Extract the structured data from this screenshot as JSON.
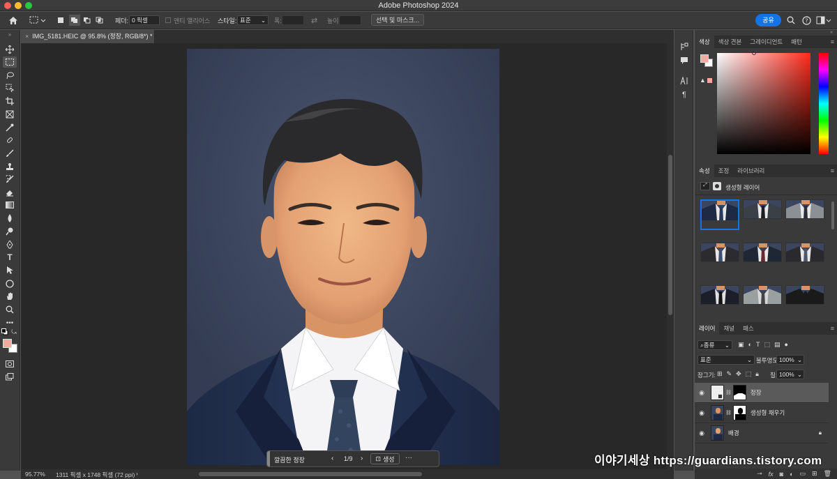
{
  "window": {
    "title": "Adobe Photoshop 2024"
  },
  "options_bar": {
    "feather_label": "페더:",
    "feather_value": "0 픽셀",
    "antialias_label": "앤티 앨리어스",
    "style_label": "스타일:",
    "style_value": "표준",
    "width_label": "폭:",
    "height_label": "높이:",
    "select_mask_button": "선택 및 마스크...",
    "share_button": "공유"
  },
  "document": {
    "tab_title": "IMG_5181.HEIC @ 95.8% (정장, RGB/8*) *",
    "zoom": "95.77%",
    "info": "1311 픽셀 x 1748 픽셀 (72 ppi)"
  },
  "context_bar": {
    "prompt": "깔끔한 정장",
    "page": "1/9",
    "generate_button": "생성"
  },
  "colors": {
    "foreground": "#f4a9a0",
    "background": "#ffffff",
    "accent": "#1473e6",
    "photo_bg": "#3b4560"
  },
  "color_panel": {
    "tabs": [
      "색상",
      "색상 견본",
      "그레이디언트",
      "패턴"
    ]
  },
  "properties_panel": {
    "tabs": [
      "속성",
      "조정",
      "라이브러리"
    ],
    "layer_type": "생성형 레이어",
    "variations": [
      {
        "shirt": "#e8e8e8",
        "suit": "#1e2a44",
        "tie": "#283a5a"
      },
      {
        "shirt": "#e8e8e8",
        "suit": "#3a3f48",
        "tie": "#1c1c24"
      },
      {
        "shirt": "#e8e8e8",
        "suit": "#8c8f94",
        "tie": "#2a2d36"
      },
      {
        "shirt": "#e8e8e8",
        "suit": "#2c2c30",
        "tie": "#3b5070"
      },
      {
        "shirt": "#e8e8e8",
        "suit": "#202734",
        "tie": "#6a2a30"
      },
      {
        "shirt": "#e8e8e8",
        "suit": "#2a2a2e",
        "tie": "#50556a"
      },
      {
        "shirt": "#e0e0e0",
        "suit": "#1c1f2a",
        "tie": "#111"
      },
      {
        "shirt": "#d8d8d8",
        "suit": "#9aa0a0",
        "tie": "#444"
      },
      {
        "shirt": "#1a1a1a",
        "suit": "#1a1a1a",
        "tie": "#1a1a1a"
      }
    ]
  },
  "layers_panel": {
    "tabs": [
      "레이어",
      "채널",
      "패스"
    ],
    "filter_kind": "종류",
    "blend_mode": "표준",
    "opacity_label": "불투명도:",
    "opacity_value": "100%",
    "lock_label": "잠그기:",
    "fill_label": "칠:",
    "fill_value": "100%",
    "layers": [
      {
        "name": "정장",
        "selected": true
      },
      {
        "name": "생성형 채우기",
        "selected": false
      },
      {
        "name": "배경",
        "selected": false,
        "locked": true
      }
    ]
  },
  "watermark": "이야기세상 https://guardians.tistory.com"
}
